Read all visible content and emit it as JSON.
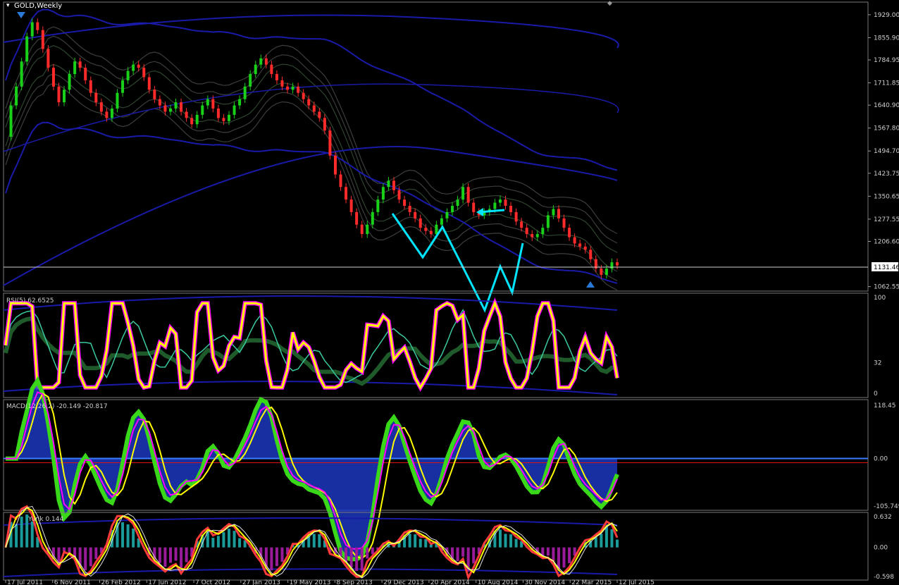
{
  "colors": {
    "background": "#000000",
    "bull": "#19d119",
    "bear": "#ff2b2b",
    "yellow": "#ffff00",
    "magenta": "#ff00ff",
    "cyan": "#00e5ff",
    "navy": "#1a1aa8",
    "gray": "#9a9a9a"
  },
  "chart_data": [
    {
      "type": "line",
      "panel": "price",
      "title": "GOLD,Weekly",
      "price_labels": [
        "1929.00",
        "1855.90",
        "1784.95",
        "1711.85",
        "1640.90",
        "1567.80",
        "1494.70",
        "1423.75",
        "1350.65",
        "1277.55",
        "1206.60",
        "1131.46",
        "1062.55"
      ],
      "price_ticks": [
        1929.0,
        1855.9,
        1784.95,
        1711.85,
        1640.9,
        1567.8,
        1494.7,
        1423.75,
        1350.65,
        1277.55,
        1206.6,
        1062.55
      ],
      "current_price": 1131.46,
      "current_price_label": "1131.46",
      "ylim": [
        1055,
        1940
      ],
      "close": [
        1540,
        1640,
        1700,
        1780,
        1860,
        1905,
        1880,
        1820,
        1760,
        1700,
        1650,
        1690,
        1740,
        1780,
        1760,
        1720,
        1680,
        1650,
        1620,
        1600,
        1630,
        1680,
        1720,
        1750,
        1770,
        1760,
        1730,
        1690,
        1660,
        1640,
        1620,
        1630,
        1650,
        1620,
        1600,
        1580,
        1610,
        1640,
        1660,
        1630,
        1600,
        1590,
        1610,
        1640,
        1660,
        1700,
        1740,
        1770,
        1790,
        1770,
        1740,
        1720,
        1700,
        1690,
        1700,
        1680,
        1660,
        1640,
        1620,
        1600,
        1560,
        1480,
        1420,
        1380,
        1340,
        1300,
        1260,
        1230,
        1260,
        1300,
        1340,
        1380,
        1400,
        1370,
        1340,
        1320,
        1300,
        1280,
        1250,
        1240,
        1230,
        1260,
        1280,
        1300,
        1320,
        1340,
        1380,
        1330,
        1300,
        1290,
        1300,
        1310,
        1330,
        1340,
        1320,
        1300,
        1270,
        1250,
        1230,
        1220,
        1230,
        1250,
        1290,
        1310,
        1280,
        1250,
        1220,
        1200,
        1190,
        1180,
        1150,
        1120,
        1100,
        1120,
        1140,
        1130
      ]
    },
    {
      "type": "line",
      "panel": "rsi",
      "label": "RSI(5) 62.6525",
      "yticks": [
        0,
        32,
        100
      ],
      "ytick_labels": [
        "0",
        "32",
        "100"
      ],
      "ylim": [
        0,
        100
      ]
    },
    {
      "type": "area",
      "panel": "macd",
      "label": "MACD(12,26,2) -20.149 -20.817",
      "yticks": [
        118.45,
        0,
        -105.749
      ],
      "ytick_labels": [
        "118.45",
        "0.00",
        "-105.749"
      ],
      "ylim": [
        -105.749,
        118.45
      ]
    },
    {
      "type": "bar",
      "panel": "oscillator",
      "label": "Yurik 0.144",
      "yticks": [
        0.632,
        0,
        -0.598
      ],
      "ytick_labels": [
        "0.632",
        "0.00",
        "-0.598"
      ],
      "ylim": [
        -0.598,
        0.632
      ]
    }
  ],
  "x_axis_labels": [
    "17 Jul 2011",
    "6 Nov 2011",
    "26 Feb 2012",
    "17 Jun 2012",
    "7 Oct 2012",
    "27 Jan 2013",
    "19 May 2013",
    "8 Sep 2013",
    "29 Dec 2013",
    "20 Apr 2014",
    "10 Aug 2014",
    "30 Nov 2014",
    "22 Mar 2015",
    "12 Jul 2015"
  ]
}
